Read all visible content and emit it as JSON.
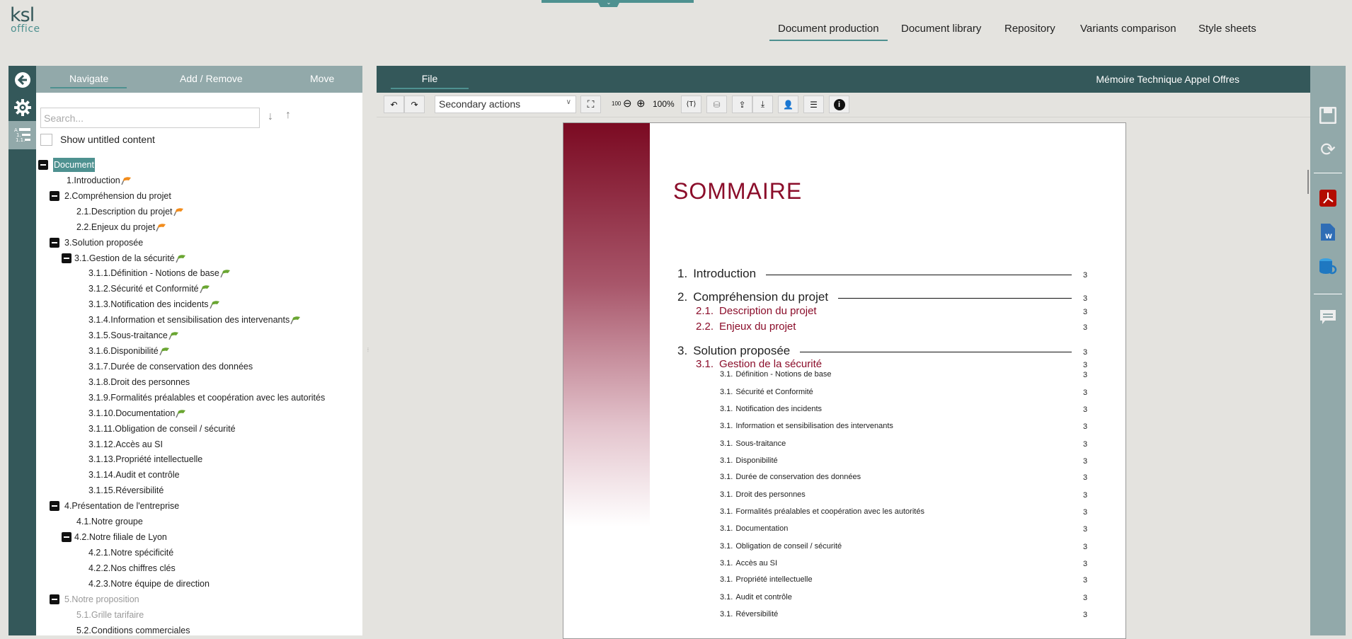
{
  "logo": {
    "line1": "KSL",
    "line2": "OFFICE"
  },
  "top_nav": {
    "tabs": [
      {
        "label": "Document production",
        "active": true
      },
      {
        "label": "Document library",
        "active": false
      },
      {
        "label": "Repository",
        "active": false
      },
      {
        "label": "Variants comparison",
        "active": false
      },
      {
        "label": "Style sheets",
        "active": false
      }
    ]
  },
  "left_rail": {
    "icons": [
      "back-arrow-icon",
      "gear-icon",
      "outline-numbering-icon"
    ]
  },
  "left_panel": {
    "tabs": [
      {
        "label": "Navigate",
        "active": true
      },
      {
        "label": "Add / Remove"
      },
      {
        "label": "Move"
      }
    ],
    "search": {
      "placeholder": "Search...",
      "value": ""
    },
    "show_untitled_label": "Show untitled content",
    "show_untitled_checked": false,
    "tree": [
      {
        "label": "Document",
        "level": 0,
        "toggle": true,
        "selected": true
      },
      {
        "label": "1.Introduction",
        "level": 1,
        "flag": "orange"
      },
      {
        "label": "2.Compréhension du projet",
        "level": 1,
        "toggle": true
      },
      {
        "label": "2.1.Description du projet",
        "level": 2,
        "flag": "orange"
      },
      {
        "label": "2.2.Enjeux du projet",
        "level": 2,
        "flag": "orange"
      },
      {
        "label": "3.Solution proposée",
        "level": 1,
        "toggle": true
      },
      {
        "label": "3.1.Gestion de la sécurité",
        "level": 2,
        "toggle": true,
        "flag": "green"
      },
      {
        "label": "3.1.1.Définition - Notions de base",
        "level": 3,
        "flag": "green"
      },
      {
        "label": "3.1.2.Sécurité et Conformité",
        "level": 3,
        "flag": "green"
      },
      {
        "label": "3.1.3.Notification des incidents",
        "level": 3,
        "flag": "green"
      },
      {
        "label": "3.1.4.Information et sensibilisation des intervenants",
        "level": 3,
        "flag": "green"
      },
      {
        "label": "3.1.5.Sous-traitance",
        "level": 3,
        "flag": "green"
      },
      {
        "label": "3.1.6.Disponibilité",
        "level": 3,
        "flag": "green"
      },
      {
        "label": "3.1.7.Durée de conservation des données",
        "level": 3
      },
      {
        "label": "3.1.8.Droit des personnes",
        "level": 3
      },
      {
        "label": "3.1.9.Formalités préalables et coopération avec les autorités",
        "level": 3
      },
      {
        "label": "3.1.10.Documentation",
        "level": 3,
        "flag": "green"
      },
      {
        "label": "3.1.11.Obligation de conseil / sécurité",
        "level": 3
      },
      {
        "label": "3.1.12.Accès au SI",
        "level": 3
      },
      {
        "label": "3.1.13.Propriété intellectuelle",
        "level": 3
      },
      {
        "label": "3.1.14.Audit et contrôle",
        "level": 3
      },
      {
        "label": "3.1.15.Réversibilité",
        "level": 3
      },
      {
        "label": "4.Présentation de l'entreprise",
        "level": 1,
        "toggle": true
      },
      {
        "label": "4.1.Notre groupe",
        "level": 2
      },
      {
        "label": "4.2.Notre filiale de Lyon",
        "level": 2,
        "toggle": true
      },
      {
        "label": "4.2.1.Notre spécificité",
        "level": 3
      },
      {
        "label": "4.2.2.Nos chiffres clés",
        "level": 3
      },
      {
        "label": "4.2.3.Notre équipe de direction",
        "level": 3
      },
      {
        "label": "5.Notre proposition",
        "level": 1,
        "toggle": true,
        "dim": true
      },
      {
        "label": "5.1.Grille tarifaire",
        "level": 2,
        "dim": true
      },
      {
        "label": "5.2.Conditions commerciales",
        "level": 2
      }
    ]
  },
  "main": {
    "file_tab": "File",
    "document_title": "Mémoire Technique Appel Offres",
    "toolbar": {
      "secondary_actions": "Secondary actions",
      "zoom_100_small": "100",
      "zoom_level": "100%"
    },
    "page": {
      "heading": "SOMMAIRE",
      "toc": [
        {
          "num": "1.",
          "title": "Introduction",
          "page": "3",
          "level": 1
        },
        {
          "num": "2.",
          "title": "Compréhension du projet",
          "page": "3",
          "level": 1
        },
        {
          "num": "2.1.",
          "title": "Description du projet",
          "page": "3",
          "level": 2
        },
        {
          "num": "2.2.",
          "title": "Enjeux du projet",
          "page": "3",
          "level": 2
        },
        {
          "num": "3.",
          "title": "Solution proposée",
          "page": "3",
          "level": 1
        },
        {
          "num": "3.1.",
          "title": "Gestion de la sécurité",
          "page": "3",
          "level": 2
        },
        {
          "num": "3.1.",
          "title": "Définition - Notions de base",
          "page": "3",
          "level": 3
        },
        {
          "num": "3.1.",
          "title": "Sécurité et Conformité",
          "page": "3",
          "level": 3
        },
        {
          "num": "3.1.",
          "title": "Notification des incidents",
          "page": "3",
          "level": 3
        },
        {
          "num": "3.1.",
          "title": "Information et sensibilisation des intervenants",
          "page": "3",
          "level": 3
        },
        {
          "num": "3.1.",
          "title": "Sous-traitance",
          "page": "3",
          "level": 3
        },
        {
          "num": "3.1.",
          "title": "Disponibilité",
          "page": "3",
          "level": 3
        },
        {
          "num": "3.1.",
          "title": "Durée de conservation des données",
          "page": "3",
          "level": 3
        },
        {
          "num": "3.1.",
          "title": "Droit des personnes",
          "page": "3",
          "level": 3
        },
        {
          "num": "3.1.",
          "title": "Formalités préalables et coopération avec les autorités",
          "page": "3",
          "level": 3
        },
        {
          "num": "3.1.",
          "title": "Documentation",
          "page": "3",
          "level": 3
        },
        {
          "num": "3.1.",
          "title": "Obligation de conseil / sécurité",
          "page": "3",
          "level": 3
        },
        {
          "num": "3.1.",
          "title": "Accès au SI",
          "page": "3",
          "level": 3
        },
        {
          "num": "3.1.",
          "title": "Propriété intellectuelle",
          "page": "3",
          "level": 3
        },
        {
          "num": "3.1.",
          "title": "Audit et contrôle",
          "page": "3",
          "level": 3
        },
        {
          "num": "3.1.",
          "title": "Réversibilité",
          "page": "3",
          "level": 3
        }
      ]
    }
  },
  "right_rail": {
    "icons": [
      "save-icon",
      "refresh-icon",
      "pdf-export-icon",
      "word-export-icon",
      "database-sync-icon",
      "comment-icon"
    ]
  },
  "colors": {
    "dark_teal": "#34585a",
    "light_teal": "#92a9aa",
    "accent": "#4e9190",
    "maroon": "#8b0d2a",
    "flag_orange": "#f28c1c",
    "flag_green": "#6aa632"
  }
}
